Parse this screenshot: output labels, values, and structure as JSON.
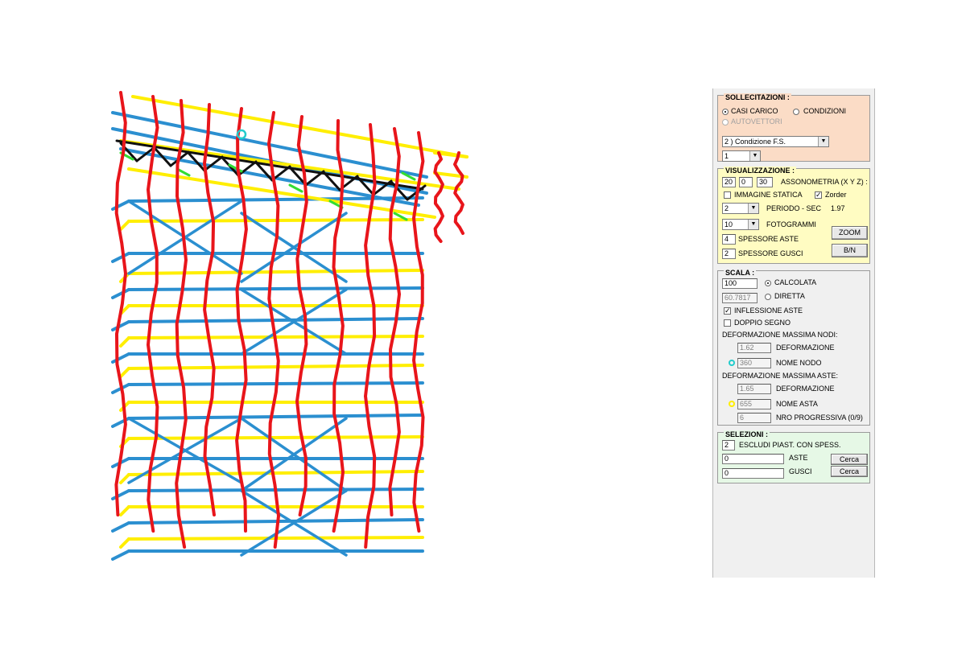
{
  "colors": {
    "columns": "#e8151b",
    "beams_blue": "#2b8fd0",
    "beams_yellow": "#ffee00",
    "truss_black": "#111111",
    "links_green": "#33dd33",
    "node_marker": "#22cccc",
    "sollecitazioni_bg": "#fbdcc6",
    "visualizzazione_bg": "#fffcc2",
    "scala_bg": "#f0f0f0",
    "selezioni_bg": "#e6f8e6"
  },
  "sollecitazioni": {
    "title": "SOLLECITAZIONI :",
    "opt_casi": "CASI CARICO",
    "opt_condizioni": "CONDIZIONI",
    "opt_autovettori": "AUTOVETTORI",
    "selected": "casi",
    "condition_select": "2 ) Condizione F.S.",
    "index_select": "1"
  },
  "visualizzazione": {
    "title": "VISUALIZZAZIONE :",
    "axo_x": "20",
    "axo_y": "0",
    "axo_z": "30",
    "axo_label": "ASSONOMETRIA (X Y Z) :",
    "immagine_statica": "IMMAGINE STATICA",
    "immagine_checked": false,
    "zorder": "Zorder",
    "zorder_checked": true,
    "periodo_value": "2",
    "periodo_label": "PERIODO - SEC",
    "periodo_sec": "1.97",
    "fotogrammi_value": "10",
    "fotogrammi_label": "FOTOGRAMMI",
    "spessore_aste_value": "4",
    "spessore_aste_label": "SPESSORE ASTE",
    "spessore_gusci_value": "2",
    "spessore_gusci_label": "SPESSORE GUSCI",
    "zoom_button": "ZOOM",
    "bn_button": "B/N"
  },
  "scala": {
    "title": "SCALA :",
    "calcolata_value": "100",
    "calcolata_label": "CALCOLATA",
    "diretta_value": "60.7817",
    "diretta_label": "DIRETTA",
    "selected": "calcolata",
    "inflessione_label": "INFLESSIONE ASTE",
    "inflessione_checked": true,
    "doppio_label": "DOPPIO SEGNO",
    "doppio_checked": false,
    "def_nodi_header": "DEFORMAZIONE MASSIMA NODI:",
    "nodi_deformazione_value": "1.62",
    "nodi_deformazione_label": "DEFORMAZIONE",
    "nome_nodo_value": "360",
    "nome_nodo_label": "NOME NODO",
    "def_aste_header": "DEFORMAZIONE MASSIMA ASTE:",
    "aste_deformazione_value": "1.65",
    "aste_deformazione_label": "DEFORMAZIONE",
    "nome_asta_value": "655",
    "nome_asta_label": "NOME ASTA",
    "nro_value": "6",
    "nro_label": "NRO PROGRESSIVA (0/9)"
  },
  "selezioni": {
    "title": "SELEZIONI :",
    "escludi_value": "2",
    "escludi_label": "ESCLUDI PIAST. CON SPESS.",
    "aste_value": "0",
    "aste_label": "ASTE",
    "gusci_value": "0",
    "gusci_label": "GUSCI",
    "cerca_label": "Cerca"
  }
}
